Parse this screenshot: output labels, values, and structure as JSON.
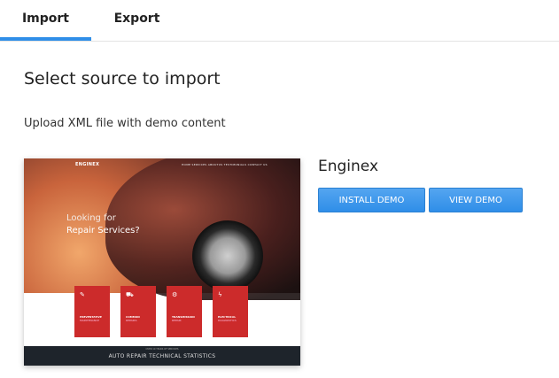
{
  "tabs": [
    {
      "label": "Import",
      "active": true
    },
    {
      "label": "Export",
      "active": false
    }
  ],
  "main": {
    "title": "Select source to import",
    "subtitle": "Upload XML file with demo content"
  },
  "demo": {
    "name": "Enginex",
    "install_label": "INSTALL DEMO",
    "view_label": "VIEW DEMO",
    "preview": {
      "logo": "ENGINEX",
      "nav": "HOME  SERVICES  ABOUTUS  TESTIMONIALS  CONTACT US",
      "hero_line1": "Looking for",
      "hero_line2": "Repair Services?",
      "cards": [
        {
          "line1": "PREVENTATIVE",
          "line2": "MAINTENANCE",
          "icon": "wrench-icon"
        },
        {
          "line1": "COMMON",
          "line2": "REPAIRS",
          "icon": "car-icon"
        },
        {
          "line1": "TRANSMISSION",
          "line2": "REPAIR",
          "icon": "gear-icon"
        },
        {
          "line1": "ELECTRICAL",
          "line2": "DIAGNOSTICS",
          "icon": "bolt-icon"
        }
      ],
      "footer_small": "OVER 10 YEARS OF SERVICES",
      "footer_big": "AUTO REPAIR TECHNICAL STATISTICS"
    }
  },
  "colors": {
    "accent": "#2f8ee8",
    "card_red": "#cc2b2b",
    "footer_dark": "#1e242b"
  }
}
